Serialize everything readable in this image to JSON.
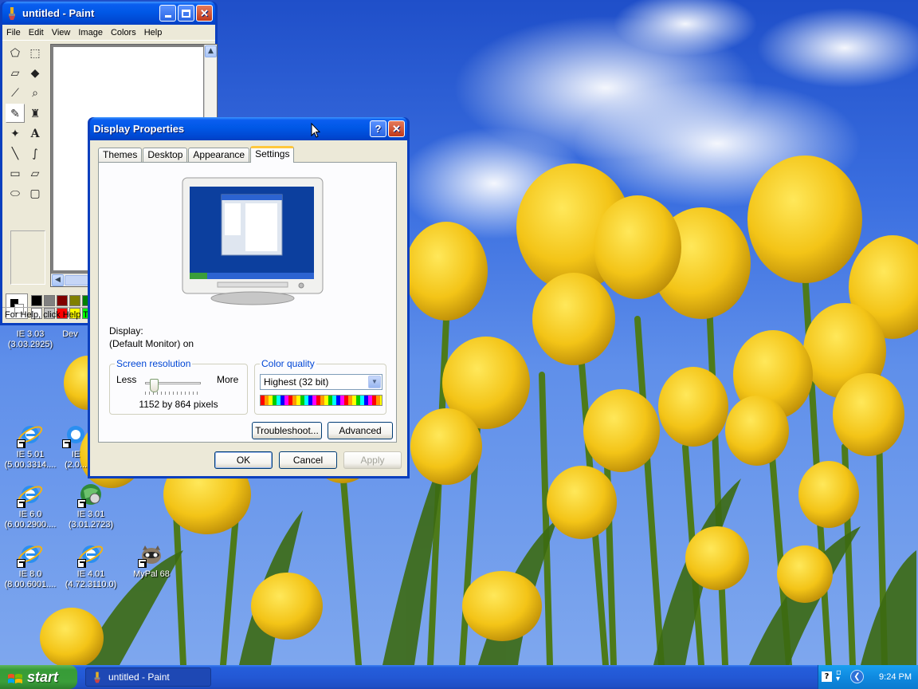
{
  "colors": {
    "xp_blue": "#0058e6",
    "dialog_bg": "#ece9d8",
    "start_green": "#379c37",
    "tab_highlight": "#ffc83c",
    "group_label": "#0046d5"
  },
  "desktop": {
    "icons": [
      {
        "name": "IE 3.03",
        "sub": "(3.03.2925)",
        "icon": "ie-icon"
      },
      {
        "name": "Dev",
        "sub": "",
        "icon": "folder-icon"
      },
      {
        "name": "IE 5.01",
        "sub": "(5.00.3314....",
        "icon": "ie-icon"
      },
      {
        "name": "IE",
        "sub": "(2.0...",
        "icon": "ie-icon"
      },
      {
        "name": "IE 6.0",
        "sub": "(6.00.2900....",
        "icon": "ie-icon"
      },
      {
        "name": "IE 3.01",
        "sub": "(3.01.2723)",
        "icon": "ie-globe-icon"
      },
      {
        "name": "IE 8.0",
        "sub": "(8.00.6001....",
        "icon": "ie-icon"
      },
      {
        "name": "IE 4.01",
        "sub": "(4.72.3110.0)",
        "icon": "ie-icon"
      },
      {
        "name": "MyPal 68",
        "sub": "",
        "icon": "raccoon-icon"
      }
    ]
  },
  "paint": {
    "title": "untitled - Paint",
    "menu": [
      "File",
      "Edit",
      "View",
      "Image",
      "Colors",
      "Help"
    ],
    "status": "For Help, click Help Topics on the Help Menu.",
    "palette": [
      "#000000",
      "#808080",
      "#800000",
      "#808000",
      "#008000",
      "#ffffff",
      "#c0c0c0",
      "#ff0000",
      "#ffff00",
      "#00ff00"
    ]
  },
  "display": {
    "title": "Display Properties",
    "tabs": [
      "Themes",
      "Desktop",
      "Appearance",
      "Settings"
    ],
    "active_tab": "Settings",
    "display_label": "Display:",
    "display_value": "(Default Monitor) on",
    "resolution_group": "Screen resolution",
    "less": "Less",
    "more": "More",
    "resolution_value": "1152 by 864 pixels",
    "color_group": "Color quality",
    "color_value": "Highest (32 bit)",
    "troubleshoot": "Troubleshoot...",
    "advanced": "Advanced",
    "ok": "OK",
    "cancel": "Cancel",
    "apply": "Apply"
  },
  "taskbar": {
    "start": "start",
    "task_item": "untitled - Paint",
    "clock": "9:24 PM"
  }
}
